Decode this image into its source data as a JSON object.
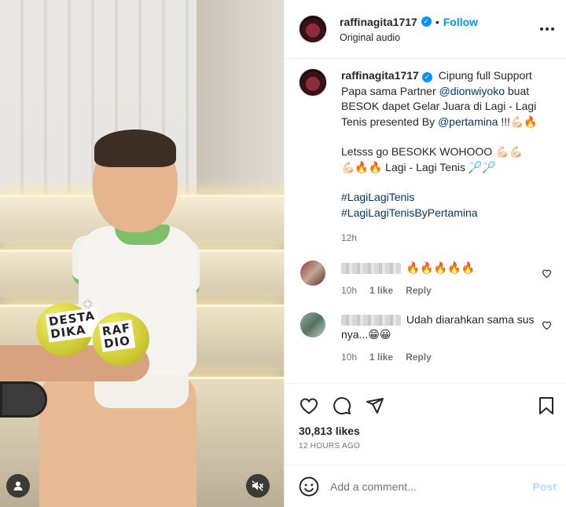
{
  "post": {
    "username": "raffinagita1717",
    "separator": "•",
    "follow_label": "Follow",
    "audio": "Original audio",
    "more_label": "•••"
  },
  "media": {
    "ball_left_text": "DESTA\nDIKA",
    "ball_right_text": "RAF\nDIO",
    "sparkle": "✦"
  },
  "caption": {
    "username": "raffinagita1717",
    "part1": "Cipung full Support Papa sama Partner",
    "mention1": "@dionwiyoko",
    "part2": "buat BESOK dapet Gelar Juara di Lagi - Lagi Tenis presented By",
    "mention2": "@pertamina",
    "part3": "!!!💪🏻🔥",
    "para2_a": "Letsss go BESOKK WOHOOO 💪🏻💪🏻",
    "para2_b": "💪🏻🔥🔥 Lagi - Lagi Tenis 🏸🏸",
    "hashtag1": "#LagiLagiTenis",
    "hashtag2": "#LagiLagiTenisByPertamina",
    "time": "12h"
  },
  "comments": [
    {
      "text": "🔥🔥🔥🔥🔥",
      "time": "10h",
      "likes": "1 like",
      "reply": "Reply"
    },
    {
      "text": "Udah diarahkan sama sus nya...😁😀",
      "time": "10h",
      "likes": "1 like",
      "reply": "Reply"
    }
  ],
  "engagement": {
    "likes": "30,813 likes",
    "date": "12 HOURS AGO"
  },
  "composer": {
    "placeholder": "Add a comment...",
    "post_label": "Post"
  },
  "colors": {
    "accent": "#0095f6",
    "link": "#00376b",
    "muted": "#737373",
    "post_disabled": "#b3dbff"
  }
}
